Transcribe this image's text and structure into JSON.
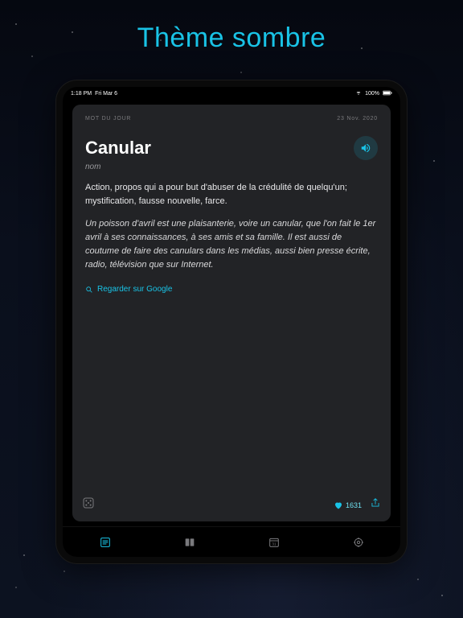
{
  "hero_title": "Thème sombre",
  "statusbar": {
    "time": "1:18 PM",
    "date": "Fri Mar 6",
    "battery": "100%"
  },
  "card": {
    "header_label": "MOT DU JOUR",
    "date": "23 Nov. 2020",
    "word": "Canular",
    "part_of_speech": "nom",
    "definition": "Action, propos qui a pour but d'abuser de la crédulité de quelqu'un; mystification, fausse nouvelle, farce.",
    "example": "Un poisson d'avril est une plaisanterie, voire un canular, que l'on fait le 1er avril à ses connaissances, à ses amis et sa famille. Il est aussi de coutume de faire des canulars dans les médias, aussi bien presse écrite, radio, télévision que sur Internet.",
    "search_link": "Regarder sur Google",
    "likes": "1631"
  },
  "icons": {
    "speaker": "speaker-icon",
    "search": "search-icon",
    "heart": "heart-icon",
    "share": "share-icon",
    "random": "random-icon",
    "tab_today": "lines-icon",
    "tab_deck": "deck-icon",
    "tab_calendar": "calendar-icon",
    "tab_settings": "gear-icon",
    "wifi": "wifi-icon",
    "battery": "battery-icon"
  }
}
